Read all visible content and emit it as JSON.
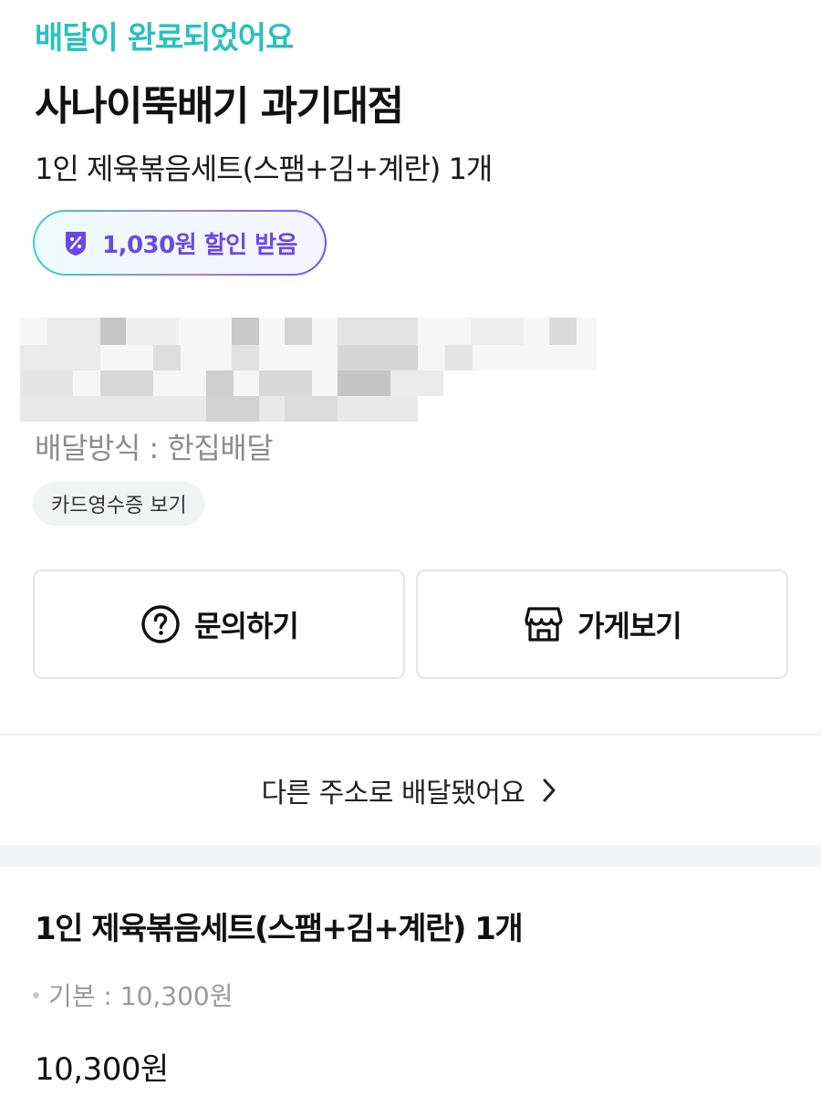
{
  "order": {
    "status": "배달이 완료되었어요",
    "store_name": "사나이뚝배기 과기대점",
    "summary": "1인 제육볶음세트(스팸+김+계란) 1개",
    "discount_label": "1,030원 할인 받음",
    "delivery_method": "배달방식 : 한집배달",
    "receipt_label": "카드영수증 보기"
  },
  "actions": {
    "inquiry_label": "문의하기",
    "store_label": "가게보기"
  },
  "address_link": {
    "label": "다른 주소로 배달됐어요"
  },
  "items": [
    {
      "name": "1인 제육볶음세트(스팸+김+계란) 1개",
      "option": "기본 : 10,300원",
      "price": "10,300원"
    }
  ],
  "icons": {
    "discount": "discount-coupon-icon",
    "inquiry": "question-circle-icon",
    "store": "store-icon",
    "chevron": "chevron-right-icon"
  },
  "colors": {
    "status": "#2ac1bc",
    "discount_text": "#6a48e8",
    "muted_text": "#8c8c8c"
  }
}
